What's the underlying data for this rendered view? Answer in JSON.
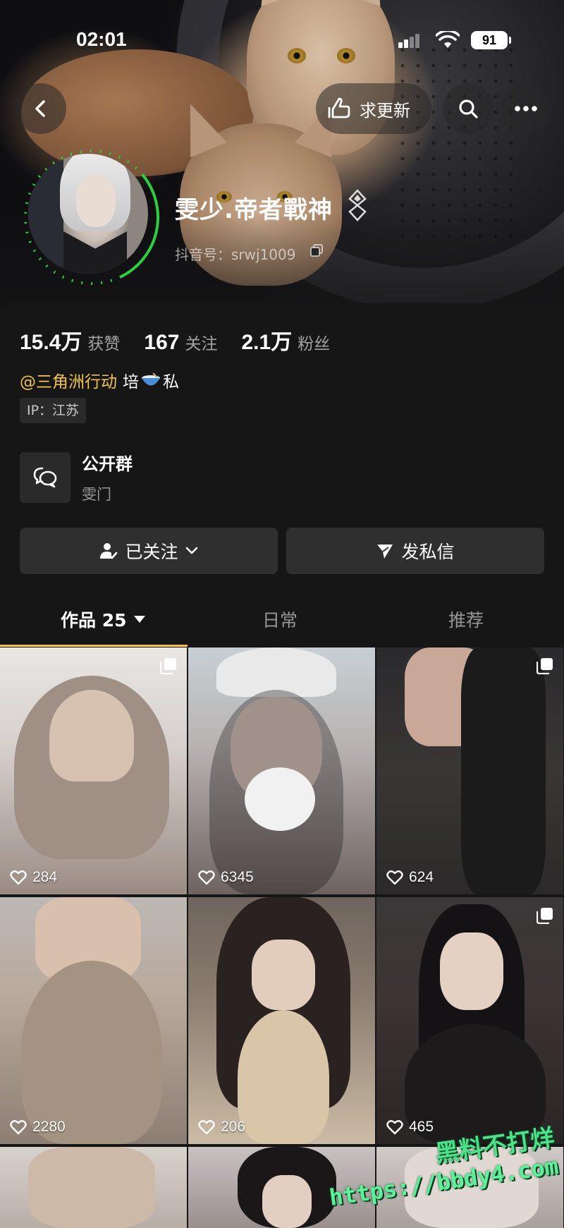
{
  "status_bar": {
    "time": "02:01",
    "battery": "91"
  },
  "top_bar": {
    "update_label": "求更新"
  },
  "profile": {
    "name": "雯少.帝者戰神",
    "douyin_id": "抖音号：srwj1009"
  },
  "stats": [
    {
      "value": "15.4万",
      "label": "获赞"
    },
    {
      "value": "167",
      "label": "关注"
    },
    {
      "value": "2.1万",
      "label": "粉丝"
    }
  ],
  "bio": {
    "mention": "@三角洲行动",
    "text_before": "培",
    "text_after": "私"
  },
  "ip": "IP：江苏",
  "group": {
    "title": "公开群",
    "subtitle": "雯门"
  },
  "buttons": {
    "follow": "已关注",
    "message": "发私信"
  },
  "tabs": [
    {
      "label": "作品 25",
      "active": true
    },
    {
      "label": "日常",
      "active": false
    },
    {
      "label": "推荐",
      "active": false
    }
  ],
  "videos": [
    {
      "likes": "284",
      "multi": true
    },
    {
      "likes": "6345",
      "multi": false
    },
    {
      "likes": "624",
      "multi": true
    },
    {
      "likes": "2280",
      "multi": false
    },
    {
      "likes": "206",
      "multi": false
    },
    {
      "likes": "465",
      "multi": true
    }
  ],
  "watermark": {
    "line1": "黑料不打烊",
    "line2": "https://bbdy4.com"
  },
  "colors": {
    "accent": "#f1c34a",
    "background": "#161616",
    "button": "#2f2f2f",
    "avatar_ring": "#2ecc40"
  }
}
